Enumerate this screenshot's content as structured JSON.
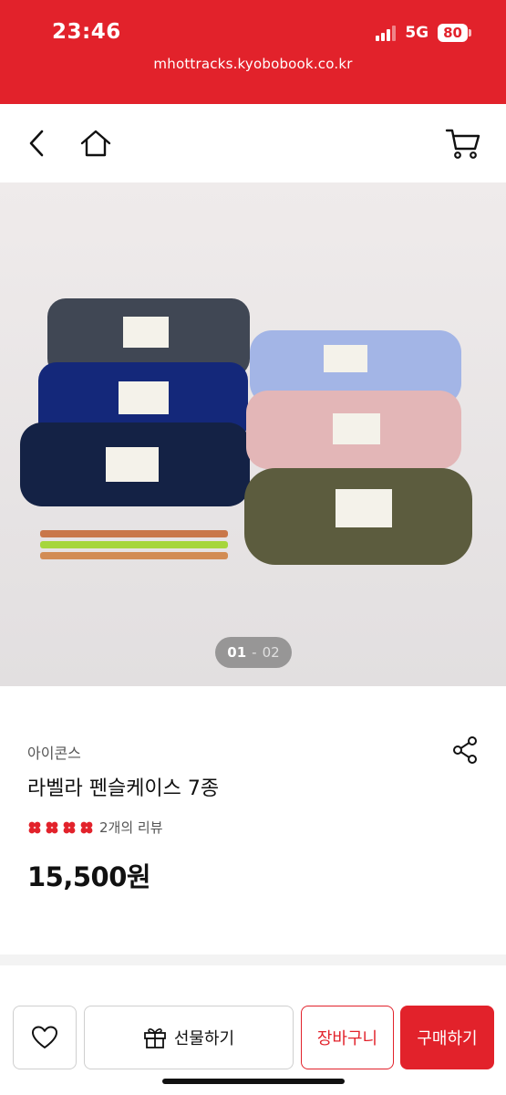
{
  "status": {
    "time": "23:46",
    "network": "5G",
    "battery": "80"
  },
  "browser": {
    "url": "mhottracks.kyobobook.co.kr"
  },
  "nav": {
    "back_icon": "chevron-left-icon",
    "home_icon": "home-icon",
    "cart_icon": "cart-icon"
  },
  "gallery": {
    "current": "01",
    "separator": "-",
    "total": "02"
  },
  "product": {
    "brand": "아이콘스",
    "title": "라벨라 펜슬케이스 7종",
    "rating_icons": [
      "clover-icon",
      "clover-icon",
      "clover-icon",
      "clover-icon"
    ],
    "review_text": "2개의 리뷰",
    "price_value": "15,500",
    "price_unit": "원"
  },
  "actions": {
    "gift_label": "선물하기",
    "cart_label": "장바구니",
    "buy_label": "구매하기"
  },
  "colors": {
    "accent": "#e2222b"
  }
}
